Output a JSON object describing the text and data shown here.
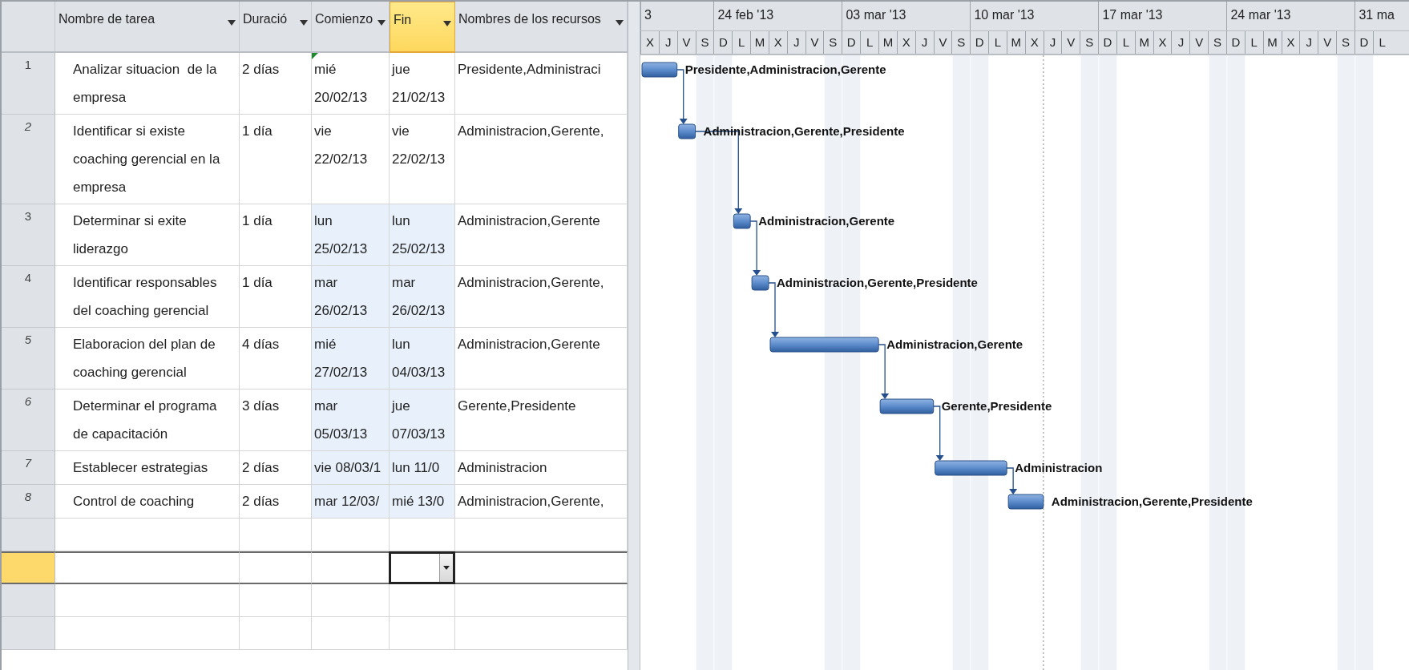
{
  "table": {
    "columns": [
      {
        "label": "Nombre de tarea",
        "selected": false
      },
      {
        "label": "Duració",
        "selected": false
      },
      {
        "label": "Comienzo",
        "selected": false
      },
      {
        "label": "Fin",
        "selected": true
      },
      {
        "label": "Nombres de los recursos",
        "selected": false
      }
    ],
    "rows": [
      {
        "id": "1",
        "id_italic": false,
        "name": "Analizar situacion  de la empresa",
        "duration": "2 días",
        "start": "mié 20/02/13",
        "finish": "jue 21/02/13",
        "resources": "Presidente,Administraci",
        "dates_changed": false,
        "start_flag": true
      },
      {
        "id": "2",
        "id_italic": true,
        "name": "Identificar si existe coaching gerencial en la empresa",
        "duration": "1 día",
        "start": "vie 22/02/13",
        "finish": "vie 22/02/13",
        "resources": "Administracion,Gerente,",
        "dates_changed": false,
        "start_flag": false
      },
      {
        "id": "3",
        "id_italic": false,
        "name": "Determinar si exite liderazgo",
        "duration": "1 día",
        "start": "lun 25/02/13",
        "finish": "lun 25/02/13",
        "resources": "Administracion,Gerente",
        "dates_changed": true,
        "start_flag": false
      },
      {
        "id": "4",
        "id_italic": false,
        "name": "Identificar responsables del coaching gerencial",
        "duration": "1 día",
        "start": "mar 26/02/13",
        "finish": "mar 26/02/13",
        "resources": "Administracion,Gerente,",
        "dates_changed": true,
        "start_flag": false
      },
      {
        "id": "5",
        "id_italic": true,
        "name": "Elaboracion del plan de coaching gerencial",
        "duration": "4 días",
        "start": "mié 27/02/13",
        "finish": "lun 04/03/13",
        "resources": "Administracion,Gerente",
        "dates_changed": true,
        "start_flag": false
      },
      {
        "id": "6",
        "id_italic": true,
        "name": "Determinar el programa de capacitación",
        "duration": "3 días",
        "start": "mar 05/03/13",
        "finish": "jue 07/03/13",
        "resources": "Gerente,Presidente",
        "dates_changed": true,
        "start_flag": false
      },
      {
        "id": "7",
        "id_italic": true,
        "name": "Establecer estrategias",
        "duration": "2 días",
        "start": "vie 08/03/1",
        "finish": "lun 11/0",
        "resources": "Administracion",
        "dates_changed": true,
        "start_flag": false
      },
      {
        "id": "8",
        "id_italic": true,
        "name": "Control de coaching",
        "duration": "2 días",
        "start": "mar 12/03/",
        "finish": "mié 13/0",
        "resources": "Administracion,Gerente,",
        "dates_changed": true,
        "start_flag": false
      }
    ],
    "blank_rows": [
      {
        "selected": false
      },
      {
        "selected": true
      },
      {
        "selected": false
      },
      {
        "selected": false
      }
    ]
  },
  "gantt": {
    "weeks": [
      "3",
      "24 feb '13",
      "03 mar '13",
      "10 mar '13",
      "17 mar '13",
      "24 mar '13",
      "31 ma"
    ],
    "days": [
      "X",
      "J",
      "V",
      "S",
      "D",
      "L",
      "M",
      "X",
      "J",
      "V",
      "S",
      "D",
      "L",
      "M",
      "X",
      "J",
      "V",
      "S",
      "D",
      "L",
      "M",
      "X",
      "J",
      "V",
      "S",
      "D",
      "L",
      "M",
      "X",
      "J",
      "V",
      "S",
      "D",
      "L",
      "M",
      "X",
      "J",
      "V",
      "S",
      "D",
      "L"
    ],
    "bar_labels": [
      "Presidente,Administracion,Gerente",
      "Administracion,Gerente,Presidente",
      "Administracion,Gerente",
      "Administracion,Gerente,Presidente",
      "Administracion,Gerente",
      "Gerente,Presidente",
      "Administracion",
      "Administracion,Gerente,Presidente"
    ]
  }
}
